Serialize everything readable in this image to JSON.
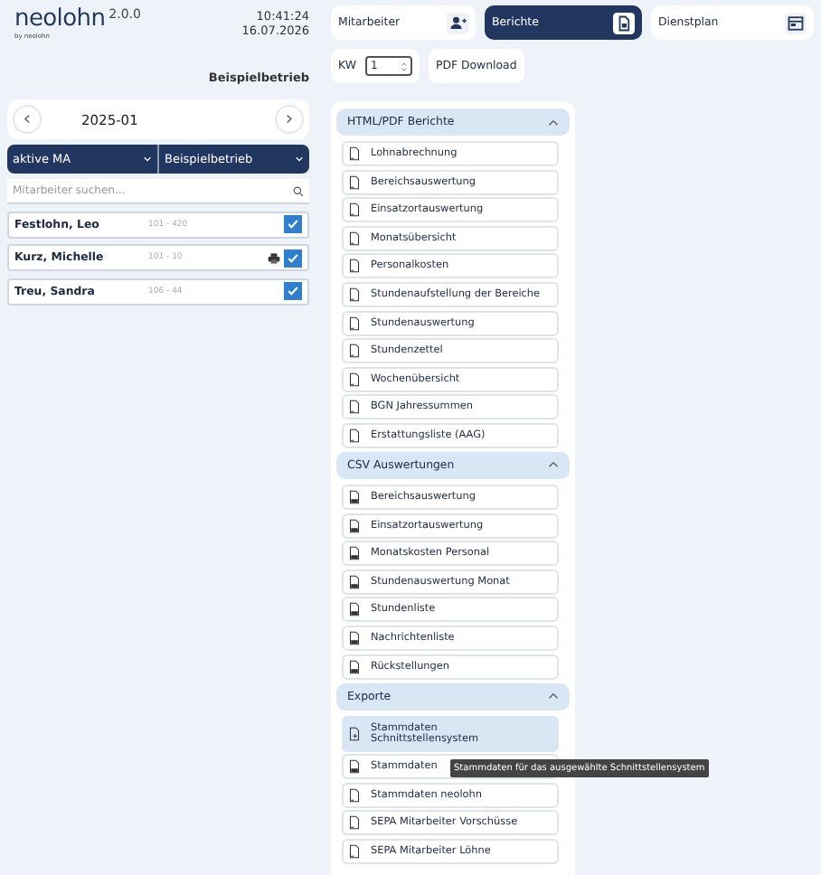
{
  "app": {
    "name": "neolohn",
    "version": "2.0.0",
    "byline": "by neolohn",
    "time": "10:41:24",
    "date": "16.07.2026",
    "company": "Beispielbetrieb"
  },
  "period": {
    "label": "2025-01",
    "prev": "‹",
    "next": "›"
  },
  "filters": [
    {
      "value": "aktive MA"
    },
    {
      "value": "Beispielbetrieb"
    }
  ],
  "search": {
    "placeholder": "Mitarbeiter suchen..."
  },
  "employees": [
    {
      "name": "Festlohn, Leo",
      "number": "101 - 420",
      "printer": false,
      "checked": true
    },
    {
      "name": "Kurz, Michelle",
      "number": "101 - 10",
      "printer": true,
      "checked": true
    },
    {
      "name": "Treu, Sandra",
      "number": "106 - 44",
      "printer": false,
      "checked": true
    }
  ],
  "tabs": [
    {
      "label": "Mitarbeiter",
      "kind": "person",
      "selected": false
    },
    {
      "label": "Berichte",
      "kind": "report",
      "selected": true
    },
    {
      "label": "Dienstplan",
      "kind": "plan",
      "selected": false
    }
  ],
  "week": {
    "label": "KW",
    "value": "1"
  },
  "pdf_button": "PDF Download",
  "sections": [
    {
      "title": "HTML/PDF Berichte",
      "expanded": true,
      "items": [
        {
          "label": "Lohnabrechnung",
          "kind": "pdf",
          "selected": false
        },
        {
          "label": "Bereichsauswertung",
          "kind": "pdf",
          "selected": false
        },
        {
          "label": "Einsatzortauswertung",
          "kind": "pdf",
          "selected": false
        },
        {
          "label": "Monatsübersicht",
          "kind": "pdf",
          "selected": false
        },
        {
          "label": "Personalkosten",
          "kind": "pdf",
          "selected": false
        },
        {
          "label": "Stundenaufstellung der Bereiche",
          "kind": "pdf",
          "selected": false
        },
        {
          "label": "Stundenauswertung",
          "kind": "pdf",
          "selected": false
        },
        {
          "label": "Stundenzettel",
          "kind": "pdf",
          "selected": false
        },
        {
          "label": "Wochenübersicht",
          "kind": "pdf",
          "selected": false
        },
        {
          "label": "BGN Jahressummen",
          "kind": "pdf",
          "selected": false
        },
        {
          "label": "Erstattungsliste (AAG)",
          "kind": "pdf",
          "selected": false
        }
      ]
    },
    {
      "title": "CSV Auswertungen",
      "expanded": true,
      "items": [
        {
          "label": "Bereichsauswertung",
          "kind": "csv",
          "selected": false
        },
        {
          "label": "Einsatzortauswertung",
          "kind": "csv",
          "selected": false
        },
        {
          "label": "Monatskosten Personal",
          "kind": "csv",
          "selected": false
        },
        {
          "label": "Stundenauswertung Monat",
          "kind": "csv",
          "selected": false
        },
        {
          "label": "Stundenliste",
          "kind": "csv",
          "selected": false
        },
        {
          "label": "Nachrichtenliste",
          "kind": "csv",
          "selected": false
        },
        {
          "label": "Rückstellungen",
          "kind": "csv",
          "selected": false
        }
      ]
    },
    {
      "title": "Exporte",
      "expanded": true,
      "items": [
        {
          "label": "Stammdaten Schnittstellensystem",
          "kind": "export",
          "selected": true
        },
        {
          "label": "Stammdaten",
          "kind": "csv",
          "selected": false
        },
        {
          "label": "Stammdaten neolohn",
          "kind": "pdf",
          "selected": false
        },
        {
          "label": "SEPA Mitarbeiter Vorschüsse",
          "kind": "pdf",
          "selected": false
        },
        {
          "label": "SEPA Mitarbeiter Löhne",
          "kind": "pdf",
          "selected": false
        }
      ]
    }
  ],
  "tooltip": "Stammdaten für das ausgewählte Schnittstellensystem"
}
